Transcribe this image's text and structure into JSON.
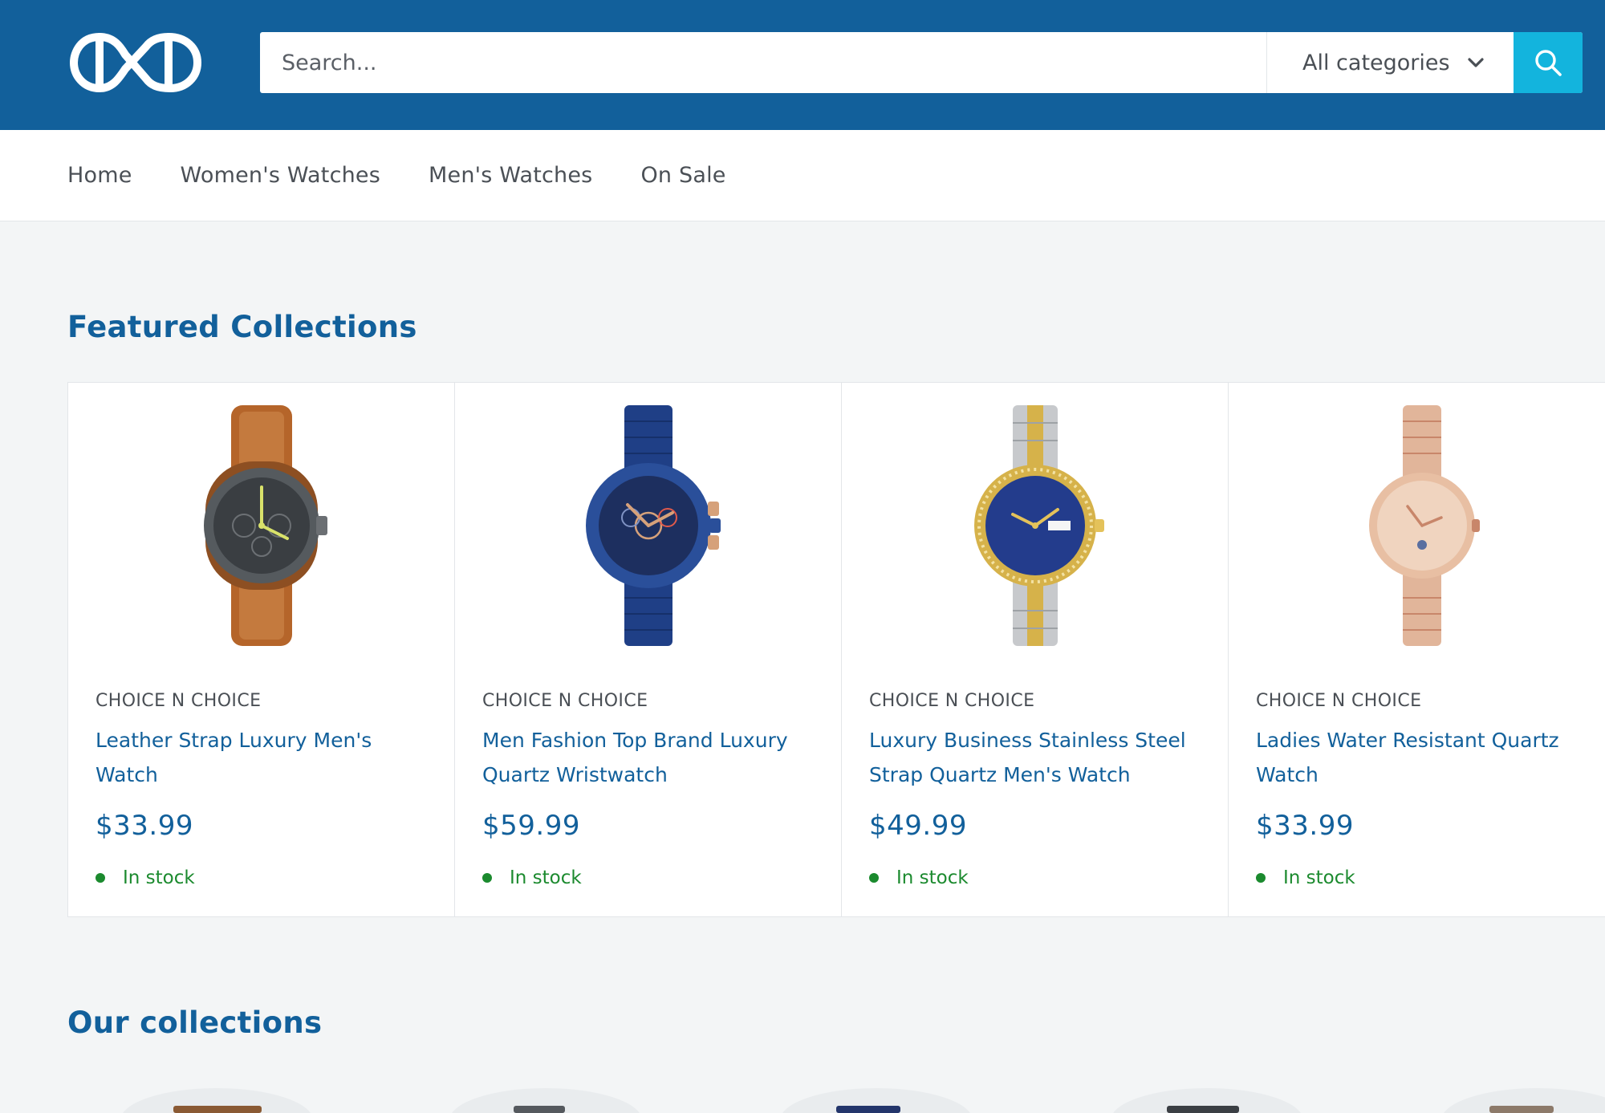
{
  "header": {
    "logo_icon": "brand-logo-icon",
    "search": {
      "placeholder": "Search..."
    },
    "category_select": {
      "selected": "All categories"
    },
    "search_button_icon": "search-icon",
    "colors": {
      "bar": "#12609b",
      "search_button": "#13b4dd"
    }
  },
  "nav": {
    "items": [
      {
        "label": "Home"
      },
      {
        "label": "Women's Watches"
      },
      {
        "label": "Men's Watches"
      },
      {
        "label": "On Sale"
      }
    ]
  },
  "featured": {
    "title": "Featured Collections",
    "products": [
      {
        "vendor": "CHOICE N CHOICE",
        "title": "Leather Strap Luxury Men's Watch",
        "price": "$33.99",
        "stock": "In stock",
        "image": {
          "strap": "#b5652a",
          "case": "#555a5e",
          "dial": "#3a3e42",
          "accent": "#d9e26a"
        }
      },
      {
        "vendor": "CHOICE N CHOICE",
        "title": "Men Fashion Top Brand Luxury Quartz Wristwatch",
        "price": "$59.99",
        "stock": "In stock",
        "image": {
          "strap": "#1f3f86",
          "case": "#2a4f9a",
          "dial": "#1d2f5f",
          "accent": "#d6a17a"
        }
      },
      {
        "vendor": "CHOICE N CHOICE",
        "title": "Luxury Business Stainless Steel Strap Quartz Men's Watch",
        "price": "$49.99",
        "stock": "In stock",
        "image": {
          "strap": "#c7c9cc",
          "case": "#d6b24a",
          "dial": "#233c8c",
          "accent": "#e4c25a"
        }
      },
      {
        "vendor": "CHOICE N CHOICE",
        "title": "Ladies Water Resistant Quartz Watch",
        "price": "$33.99",
        "stock": "In stock",
        "image": {
          "strap": "#e1b59a",
          "case": "#e8bfa3",
          "dial": "#f0d4bf",
          "accent": "#c8866a"
        }
      }
    ]
  },
  "collections": {
    "title": "Our collections"
  },
  "colors": {
    "accent": "#12609b",
    "in_stock": "#1b8a2e",
    "page_bg": "#f3f5f6"
  }
}
